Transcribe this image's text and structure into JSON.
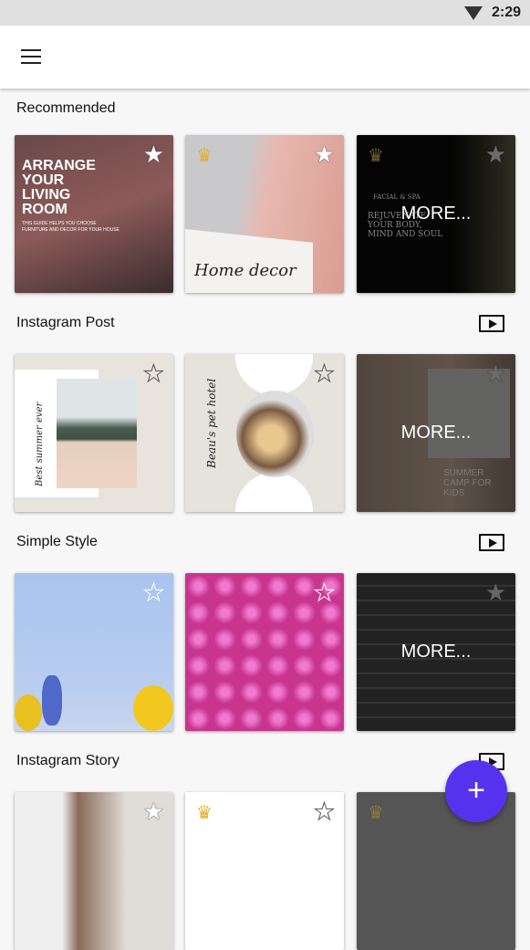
{
  "status": {
    "time": "2:29",
    "icon": "wifi-icon"
  },
  "appbar": {
    "icon": "menu-icon"
  },
  "fab": {
    "label": "+",
    "color": "#5533ee"
  },
  "more_label": "MORE...",
  "sections": [
    {
      "title": "Recommended",
      "cards": [
        {
          "title": "ARRANGE YOUR LIVING ROOM",
          "subtitle": "THIS GUIDE HELPS YOU CHOOSE FURNITURE AND DECOR FOR YOUR HOUSE",
          "premium": false
        },
        {
          "title": "Home decor",
          "premium": true
        },
        {
          "title": "FACIAL & SPA",
          "subtitle": "REJUVENATE YOUR BODY, MIND AND SOUL",
          "premium": true,
          "more": true
        }
      ]
    },
    {
      "title": "Instagram Post",
      "cards": [
        {
          "title": "Best summer ever",
          "premium": false
        },
        {
          "title": "Beau's pet hotel",
          "premium": false
        },
        {
          "title": "SUMMER CAMP FOR KIDS",
          "premium": false,
          "more": true
        }
      ]
    },
    {
      "title": "Simple Style",
      "cards": [
        {
          "premium": false
        },
        {
          "premium": false
        },
        {
          "premium": false,
          "more": true
        }
      ]
    },
    {
      "title": "Instagram Story",
      "cards": [
        {
          "premium": false
        },
        {
          "premium": true
        },
        {
          "premium": true
        }
      ]
    }
  ]
}
